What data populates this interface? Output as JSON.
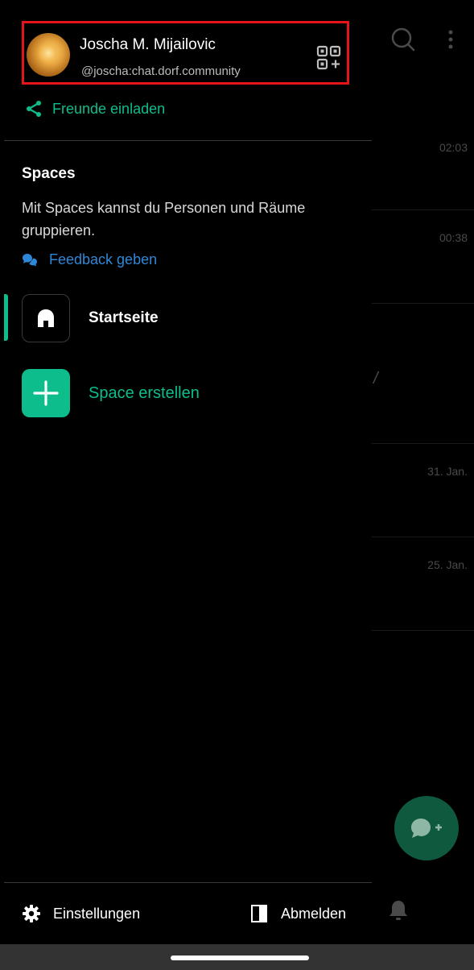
{
  "profile": {
    "name": "Joscha M. Mijailovic",
    "handle": "@joscha:chat.dorf.community"
  },
  "invite": {
    "label": "Freunde einladen"
  },
  "spaces": {
    "title": "Spaces",
    "description": "Mit Spaces kannst du Personen und Räume gruppieren.",
    "feedback_label": "Feedback geben",
    "items": [
      {
        "label": "Startseite",
        "icon": "home-icon",
        "active": true
      },
      {
        "label": "Space erstellen",
        "icon": "plus-icon",
        "active": false
      }
    ]
  },
  "footer": {
    "settings_label": "Einstellungen",
    "logout_label": "Abmelden"
  },
  "background_list": {
    "times": [
      "02:03",
      "00:38",
      "31. Jan.",
      "25. Jan."
    ]
  },
  "colors": {
    "accent": "#0dbd8b",
    "link": "#2f87d8",
    "highlight_border": "#e8141c",
    "background": "#000000"
  }
}
